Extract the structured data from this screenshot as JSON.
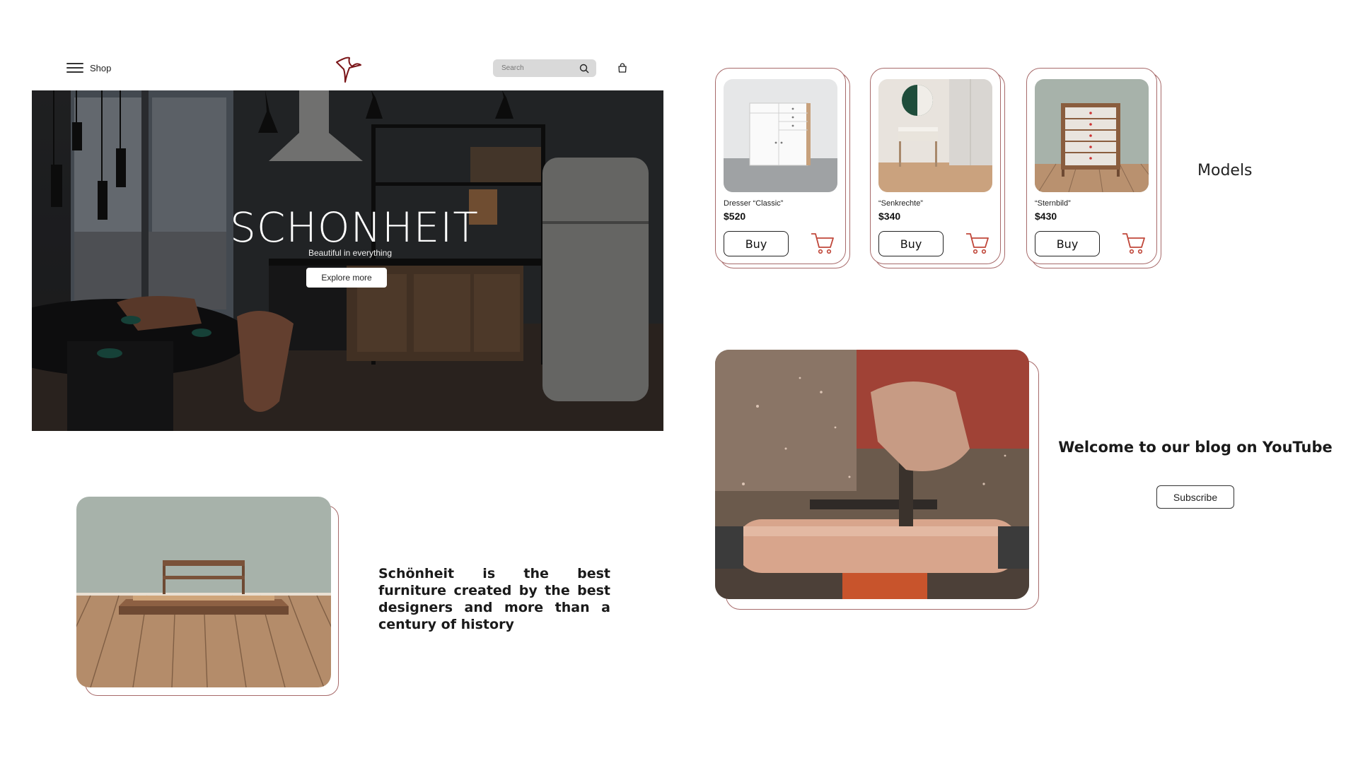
{
  "header": {
    "menu_label": "Shop",
    "search_placeholder": "Search"
  },
  "hero": {
    "brand": "SCHONHEIT",
    "tagline": "Beautiful in everything",
    "cta_label": "Explore more"
  },
  "about": {
    "text": "Schönheit is the best furniture created by the best designers and more than a century of history"
  },
  "models": {
    "section_label": "Models",
    "buy_label": "Buy",
    "products": [
      {
        "name": "Dresser “Classic”",
        "price": "$520",
        "image": "white-dresser"
      },
      {
        "name": "“Senkrechte”",
        "price": "$340",
        "image": "console-table-mirror"
      },
      {
        "name": "“Sternbild”",
        "price": "$430",
        "image": "chest-of-drawers"
      }
    ]
  },
  "blog": {
    "title": "Welcome to our blog on YouTube",
    "subscribe_label": "Subscribe"
  },
  "colors": {
    "accent": "#a76a6a",
    "cart": "#c0473a",
    "logo": "#7a1518"
  }
}
